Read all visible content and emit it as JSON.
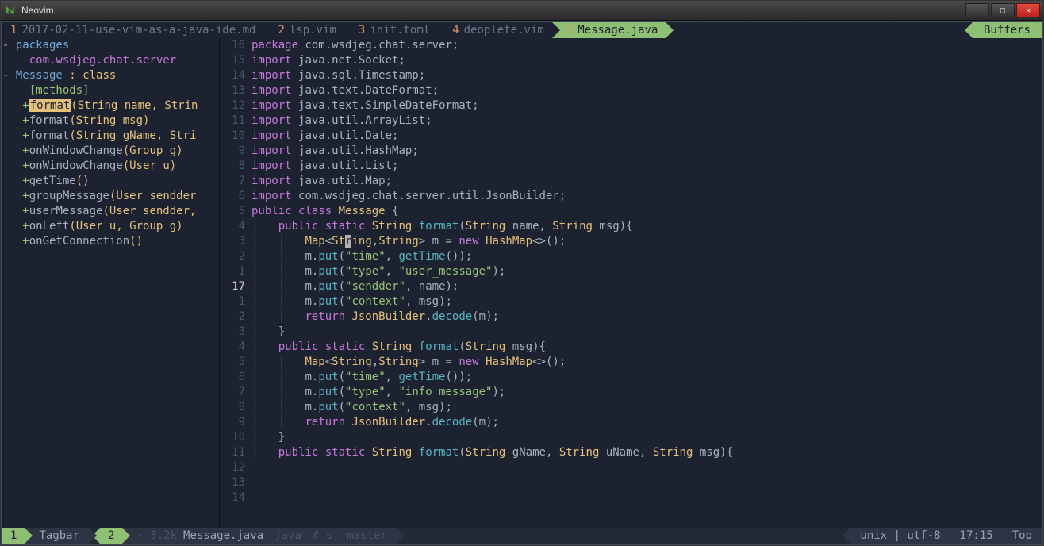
{
  "window": {
    "title": "Neovim"
  },
  "tabline": {
    "tabs": [
      {
        "num": "1",
        "label": "2017-02-11-use-vim-as-a-java-ide.md"
      },
      {
        "num": "2",
        "label": "lsp.vim"
      },
      {
        "num": "3",
        "label": "init.toml"
      },
      {
        "num": "4",
        "label": "deoplete.vim"
      },
      {
        "num": "5",
        "label": "Message.java"
      }
    ],
    "active_index": 4,
    "buffers_label": "Buffers"
  },
  "tagbar": {
    "rows": [
      {
        "prefix": "- ",
        "text": "packages",
        "cls": "tag-heading"
      },
      {
        "prefix": "    ",
        "text": "com.wsdjeg.chat.server",
        "cls": "tag-purple"
      },
      {
        "prefix": "- ",
        "text": "Message",
        "suffix": " : class",
        "cls": "tag-heading",
        "suffix_cls": "tag-sig"
      },
      {
        "prefix": "    ",
        "text": "[methods]",
        "cls": "tag-methods"
      },
      {
        "prefix": "   +",
        "text": "format",
        "highlight": true,
        "sig": "(String name, Strin"
      },
      {
        "prefix": "   +",
        "text": "format",
        "sig": "(String msg)"
      },
      {
        "prefix": "   +",
        "text": "format",
        "sig": "(String gName, Stri"
      },
      {
        "prefix": "   +",
        "text": "onWindowChange",
        "sig": "(Group g)"
      },
      {
        "prefix": "   +",
        "text": "onWindowChange",
        "sig": "(User u)"
      },
      {
        "prefix": "   +",
        "text": "getTime",
        "sig": "()"
      },
      {
        "prefix": "   +",
        "text": "groupMessage",
        "sig": "(User sendder"
      },
      {
        "prefix": "   +",
        "text": "userMessage",
        "sig": "(User sendder,"
      },
      {
        "prefix": "   +",
        "text": "onLeft",
        "sig": "(User u, Group g)"
      },
      {
        "prefix": "   +",
        "text": "onGetConnection",
        "sig": "()"
      }
    ]
  },
  "editor": {
    "gutter": [
      "16",
      "15",
      "14",
      "13",
      "12",
      "11",
      "10",
      "9",
      "8",
      "7",
      "6",
      "5",
      "4",
      "3",
      "2",
      "1",
      "17",
      "1",
      "2",
      "3",
      "4",
      "5",
      "6",
      "7",
      "8",
      "9",
      "10",
      "11",
      "12",
      "13",
      "14"
    ],
    "current_row_index": 16
  },
  "statusline": {
    "left": {
      "mode_num": "1",
      "label": "Tagbar"
    },
    "right": {
      "mode_num": "2",
      "file_prefix": "- 3.2k",
      "file": "Message.java",
      "lang": "java",
      "hash": "# s",
      "branch": "master",
      "enc": "unix | utf-8",
      "time": "17:15",
      "pos": "Top"
    }
  },
  "code_strings": {
    "pkg": "package",
    "imp": "import",
    "pub": "public",
    "cls": "class",
    "stat": "static",
    "ret": "return",
    "new": "new",
    "pkg_name": "com.wsdjeg.chat.server",
    "imports": [
      "java.net.Socket",
      "java.sql.Timestamp",
      "java.text.DateFormat",
      "java.text.SimpleDateFormat",
      "java.util.ArrayList",
      "java.util.Date",
      "java.util.HashMap",
      "java.util.List",
      "java.util.Map",
      "com.wsdjeg.chat.server.util.JsonBuilder"
    ],
    "className": "Message",
    "String": "String",
    "Map": "Map",
    "HashMap": "HashMap",
    "format": "format",
    "getTime": "getTime",
    "put": "put",
    "decode": "decode",
    "JsonBuilder": "JsonBuilder",
    "n_name": "name",
    "n_msg": "msg",
    "n_m": "m",
    "n_gName": "gName",
    "n_uName": "uName",
    "s_time": "\"time\"",
    "s_type": "\"type\"",
    "s_user": "\"user_message\"",
    "s_sendder": "\"sendder\"",
    "s_context": "\"context\"",
    "s_info": "\"info_message\""
  }
}
